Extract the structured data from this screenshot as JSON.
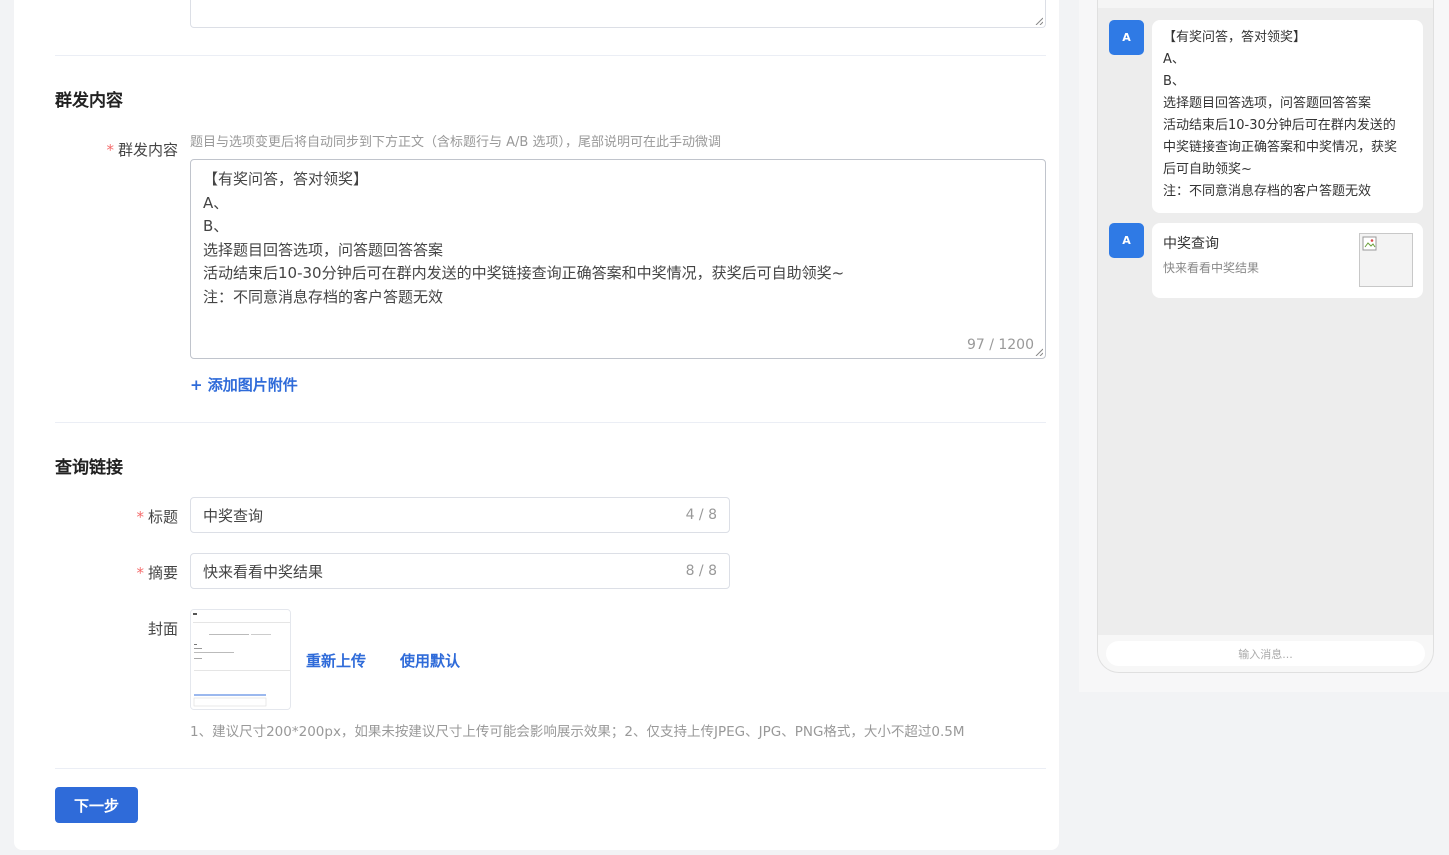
{
  "mass_section": {
    "title": "群发内容",
    "label": "群发内容",
    "hint": "题目与选项变更后将自动同步到下方正文（含标题行与 A/B 选项），尾部说明可在此手动微调",
    "content_lines": [
      "【有奖问答，答对领奖】",
      "A、",
      "B、",
      "选择题目回答选项，问答题回答答案",
      "活动结束后10-30分钟后可在群内发送的中奖链接查询正确答案和中奖情况，获奖后可自助领奖~",
      "注：不同意消息存档的客户答题无效"
    ],
    "counter": "97 / 1200",
    "add_image": "+ 添加图片附件"
  },
  "query_section": {
    "title": "查询链接",
    "title_label": "标题",
    "title_value": "中奖查询",
    "title_counter": "4 / 8",
    "summary_label": "摘要",
    "summary_value": "快来看看中奖结果",
    "summary_counter": "8 / 8",
    "cover_label": "封面",
    "reupload": "重新上传",
    "use_default": "使用默认",
    "cover_hint": "1、建议尺寸200*200px，如果未按建议尺寸上传可能会影响展示效果；2、仅支持上传JPEG、JPG、PNG格式，大小不超过0.5M"
  },
  "next_button": "下一步",
  "preview": {
    "avatar_letter": "A",
    "message_lines": [
      "【有奖问答，答对领奖】",
      "A、",
      "B、",
      "选择题目回答选项，问答题回答答案",
      "活动结束后10-30分钟后可在群内发送的",
      "中奖链接查询正确答案和中奖情况，获奖",
      "后可自助领奖~",
      "注：不同意消息存档的客户答题无效"
    ],
    "link_title": "中奖查询",
    "link_desc": "快来看看中奖结果",
    "input_placeholder": "输入消息..."
  },
  "colors": {
    "primary": "#2f6bd9",
    "required_star": "#f56c6c",
    "avatar": "#2f7ae5"
  }
}
